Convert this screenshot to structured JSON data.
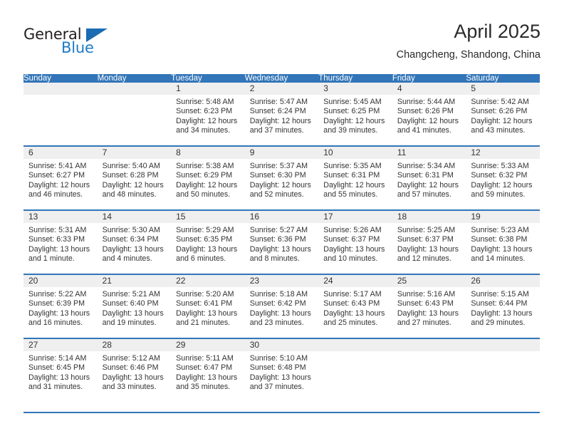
{
  "brand": {
    "name_part1": "General",
    "name_part2": "Blue",
    "triangle_color": "#1b6cb3",
    "blue_text_color": "#1e7bc4"
  },
  "header": {
    "title": "April 2025",
    "location": "Changcheng, Shandong, China"
  },
  "theme": {
    "header_row_bg": "#3275b8",
    "daynum_band_bg": "#efefef",
    "row_divider": "#3275b8",
    "text": "#333333"
  },
  "weekdays": [
    "Sunday",
    "Monday",
    "Tuesday",
    "Wednesday",
    "Thursday",
    "Friday",
    "Saturday"
  ],
  "weeks": [
    [
      {
        "day": "",
        "sunrise": "",
        "sunset": "",
        "daylight_line1": "",
        "daylight_line2": ""
      },
      {
        "day": "",
        "sunrise": "",
        "sunset": "",
        "daylight_line1": "",
        "daylight_line2": ""
      },
      {
        "day": "1",
        "sunrise": "Sunrise: 5:48 AM",
        "sunset": "Sunset: 6:23 PM",
        "daylight_line1": "Daylight: 12 hours",
        "daylight_line2": "and 34 minutes."
      },
      {
        "day": "2",
        "sunrise": "Sunrise: 5:47 AM",
        "sunset": "Sunset: 6:24 PM",
        "daylight_line1": "Daylight: 12 hours",
        "daylight_line2": "and 37 minutes."
      },
      {
        "day": "3",
        "sunrise": "Sunrise: 5:45 AM",
        "sunset": "Sunset: 6:25 PM",
        "daylight_line1": "Daylight: 12 hours",
        "daylight_line2": "and 39 minutes."
      },
      {
        "day": "4",
        "sunrise": "Sunrise: 5:44 AM",
        "sunset": "Sunset: 6:26 PM",
        "daylight_line1": "Daylight: 12 hours",
        "daylight_line2": "and 41 minutes."
      },
      {
        "day": "5",
        "sunrise": "Sunrise: 5:42 AM",
        "sunset": "Sunset: 6:26 PM",
        "daylight_line1": "Daylight: 12 hours",
        "daylight_line2": "and 43 minutes."
      }
    ],
    [
      {
        "day": "6",
        "sunrise": "Sunrise: 5:41 AM",
        "sunset": "Sunset: 6:27 PM",
        "daylight_line1": "Daylight: 12 hours",
        "daylight_line2": "and 46 minutes."
      },
      {
        "day": "7",
        "sunrise": "Sunrise: 5:40 AM",
        "sunset": "Sunset: 6:28 PM",
        "daylight_line1": "Daylight: 12 hours",
        "daylight_line2": "and 48 minutes."
      },
      {
        "day": "8",
        "sunrise": "Sunrise: 5:38 AM",
        "sunset": "Sunset: 6:29 PM",
        "daylight_line1": "Daylight: 12 hours",
        "daylight_line2": "and 50 minutes."
      },
      {
        "day": "9",
        "sunrise": "Sunrise: 5:37 AM",
        "sunset": "Sunset: 6:30 PM",
        "daylight_line1": "Daylight: 12 hours",
        "daylight_line2": "and 52 minutes."
      },
      {
        "day": "10",
        "sunrise": "Sunrise: 5:35 AM",
        "sunset": "Sunset: 6:31 PM",
        "daylight_line1": "Daylight: 12 hours",
        "daylight_line2": "and 55 minutes."
      },
      {
        "day": "11",
        "sunrise": "Sunrise: 5:34 AM",
        "sunset": "Sunset: 6:31 PM",
        "daylight_line1": "Daylight: 12 hours",
        "daylight_line2": "and 57 minutes."
      },
      {
        "day": "12",
        "sunrise": "Sunrise: 5:33 AM",
        "sunset": "Sunset: 6:32 PM",
        "daylight_line1": "Daylight: 12 hours",
        "daylight_line2": "and 59 minutes."
      }
    ],
    [
      {
        "day": "13",
        "sunrise": "Sunrise: 5:31 AM",
        "sunset": "Sunset: 6:33 PM",
        "daylight_line1": "Daylight: 13 hours",
        "daylight_line2": "and 1 minute."
      },
      {
        "day": "14",
        "sunrise": "Sunrise: 5:30 AM",
        "sunset": "Sunset: 6:34 PM",
        "daylight_line1": "Daylight: 13 hours",
        "daylight_line2": "and 4 minutes."
      },
      {
        "day": "15",
        "sunrise": "Sunrise: 5:29 AM",
        "sunset": "Sunset: 6:35 PM",
        "daylight_line1": "Daylight: 13 hours",
        "daylight_line2": "and 6 minutes."
      },
      {
        "day": "16",
        "sunrise": "Sunrise: 5:27 AM",
        "sunset": "Sunset: 6:36 PM",
        "daylight_line1": "Daylight: 13 hours",
        "daylight_line2": "and 8 minutes."
      },
      {
        "day": "17",
        "sunrise": "Sunrise: 5:26 AM",
        "sunset": "Sunset: 6:37 PM",
        "daylight_line1": "Daylight: 13 hours",
        "daylight_line2": "and 10 minutes."
      },
      {
        "day": "18",
        "sunrise": "Sunrise: 5:25 AM",
        "sunset": "Sunset: 6:37 PM",
        "daylight_line1": "Daylight: 13 hours",
        "daylight_line2": "and 12 minutes."
      },
      {
        "day": "19",
        "sunrise": "Sunrise: 5:23 AM",
        "sunset": "Sunset: 6:38 PM",
        "daylight_line1": "Daylight: 13 hours",
        "daylight_line2": "and 14 minutes."
      }
    ],
    [
      {
        "day": "20",
        "sunrise": "Sunrise: 5:22 AM",
        "sunset": "Sunset: 6:39 PM",
        "daylight_line1": "Daylight: 13 hours",
        "daylight_line2": "and 16 minutes."
      },
      {
        "day": "21",
        "sunrise": "Sunrise: 5:21 AM",
        "sunset": "Sunset: 6:40 PM",
        "daylight_line1": "Daylight: 13 hours",
        "daylight_line2": "and 19 minutes."
      },
      {
        "day": "22",
        "sunrise": "Sunrise: 5:20 AM",
        "sunset": "Sunset: 6:41 PM",
        "daylight_line1": "Daylight: 13 hours",
        "daylight_line2": "and 21 minutes."
      },
      {
        "day": "23",
        "sunrise": "Sunrise: 5:18 AM",
        "sunset": "Sunset: 6:42 PM",
        "daylight_line1": "Daylight: 13 hours",
        "daylight_line2": "and 23 minutes."
      },
      {
        "day": "24",
        "sunrise": "Sunrise: 5:17 AM",
        "sunset": "Sunset: 6:43 PM",
        "daylight_line1": "Daylight: 13 hours",
        "daylight_line2": "and 25 minutes."
      },
      {
        "day": "25",
        "sunrise": "Sunrise: 5:16 AM",
        "sunset": "Sunset: 6:43 PM",
        "daylight_line1": "Daylight: 13 hours",
        "daylight_line2": "and 27 minutes."
      },
      {
        "day": "26",
        "sunrise": "Sunrise: 5:15 AM",
        "sunset": "Sunset: 6:44 PM",
        "daylight_line1": "Daylight: 13 hours",
        "daylight_line2": "and 29 minutes."
      }
    ],
    [
      {
        "day": "27",
        "sunrise": "Sunrise: 5:14 AM",
        "sunset": "Sunset: 6:45 PM",
        "daylight_line1": "Daylight: 13 hours",
        "daylight_line2": "and 31 minutes."
      },
      {
        "day": "28",
        "sunrise": "Sunrise: 5:12 AM",
        "sunset": "Sunset: 6:46 PM",
        "daylight_line1": "Daylight: 13 hours",
        "daylight_line2": "and 33 minutes."
      },
      {
        "day": "29",
        "sunrise": "Sunrise: 5:11 AM",
        "sunset": "Sunset: 6:47 PM",
        "daylight_line1": "Daylight: 13 hours",
        "daylight_line2": "and 35 minutes."
      },
      {
        "day": "30",
        "sunrise": "Sunrise: 5:10 AM",
        "sunset": "Sunset: 6:48 PM",
        "daylight_line1": "Daylight: 13 hours",
        "daylight_line2": "and 37 minutes."
      },
      {
        "day": "",
        "sunrise": "",
        "sunset": "",
        "daylight_line1": "",
        "daylight_line2": ""
      },
      {
        "day": "",
        "sunrise": "",
        "sunset": "",
        "daylight_line1": "",
        "daylight_line2": ""
      },
      {
        "day": "",
        "sunrise": "",
        "sunset": "",
        "daylight_line1": "",
        "daylight_line2": ""
      }
    ]
  ]
}
